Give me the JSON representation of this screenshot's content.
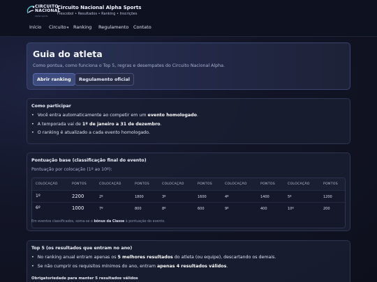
{
  "brand": {
    "logo_line1": "CIRCUITO",
    "logo_line2": "NACIONAL",
    "logo_sub": "alpha sports",
    "title": "Circuito Nacional Alpha Sports",
    "subtitle": "Frescobol • Resultados • Ranking • Inscrições"
  },
  "nav": {
    "items": [
      "Início",
      "Circuito",
      "Ranking",
      "Regulamento",
      "Contato"
    ],
    "circuito_chevron": "▾"
  },
  "hero": {
    "title": "Guia do atleta",
    "description": "Como pontua, como funciona o Top 5, regras e desempates do Circuito Nacional Alpha.",
    "primary_button": "Abrir ranking",
    "secondary_button": "Regulamento oficial"
  },
  "como_participar": {
    "title": "Como participar",
    "items": [
      {
        "pre": "Você entra automaticamente ao competir em um ",
        "bold": "evento homologado",
        "post": "."
      },
      {
        "pre": "A temporada vai de ",
        "bold": "1º de janeiro a 31 de dezembro",
        "post": "."
      },
      {
        "pre": "O ranking é atualizado a cada evento homologado.",
        "bold": "",
        "post": ""
      }
    ]
  },
  "pontuacao": {
    "title": "Pontuação base (classificação final do evento)",
    "subtitle": "Pontuação por colocação (1º ao 10º):",
    "headers": [
      "COLOCAÇÃO",
      "PONTOS",
      "COLOCAÇÃO",
      "PONTOS",
      "COLOCAÇÃO",
      "PONTOS",
      "COLOCAÇÃO",
      "PONTOS",
      "COLOCAÇÃO",
      "PONTOS"
    ],
    "rows": [
      [
        "1º",
        "2200",
        "2º",
        "1800",
        "3º",
        "1600",
        "4º",
        "1400",
        "5º",
        "1200"
      ],
      [
        "6º",
        "1000",
        "7º",
        "800",
        "8º",
        "600",
        "9º",
        "400",
        "10º",
        "200"
      ]
    ],
    "note_pre": "Em eventos classificados, soma-se o ",
    "note_bold": "bônus da Classe",
    "note_post": " à pontuação do evento."
  },
  "top5": {
    "title": "Top 5 (os resultados que entram no ano)",
    "items": [
      {
        "pre": "No ranking anual entram apenas os ",
        "bold": "5 melhores resultados",
        "post": " do atleta (ou equipe), descartando os demais."
      },
      {
        "pre": "Se não cumprir os requisitos mínimos do ano, entram ",
        "bold": "apenas 4 resultados válidos",
        "post": "."
      }
    ],
    "obrigatoriedade": "Obrigatoriedade para manter 5 resultados válidos"
  },
  "colors": {
    "background": "#121526",
    "card": "#1a1e32",
    "accent": "#3d4b7e",
    "logo_accent": "#4fc3c9"
  }
}
